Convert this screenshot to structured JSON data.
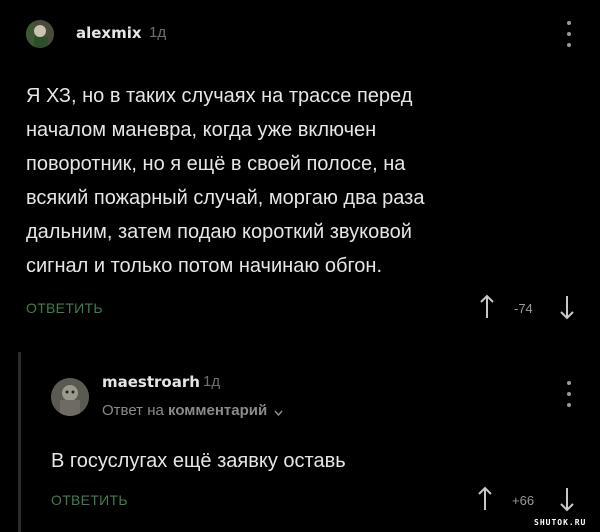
{
  "comment1": {
    "username": "alexmix",
    "time": "1д",
    "text": "Я ХЗ, но в таких случаях на трассе перед\nначалом маневра, когда уже включен\nповоротник, но я ещё в своей полосе, на\nвсякий пожарный случай, моргаю два раза\nдальним, затем подаю короткий звуковой\nсигнал и только потом начинаю обгон.",
    "reply_label": "ОТВЕТИТЬ",
    "rating": "-74"
  },
  "comment2": {
    "username": "maestroarh",
    "time": "1д",
    "reply_to_prefix": "Ответ на",
    "reply_to_target": "комментарий",
    "text": "В госуслугах ещё заявку оставь",
    "reply_label": "ОТВЕТИТЬ",
    "rating": "+66"
  },
  "watermark": "SHUTOK.RU",
  "icons": [
    "avatar",
    "kebab-menu-icon",
    "upvote-arrow-icon",
    "downvote-arrow-icon",
    "chevron-down-icon"
  ],
  "colors": {
    "background": "#000000",
    "reply": "#3e7f4a",
    "text": "#e6e6e6",
    "muted": "#6f6f6f"
  }
}
